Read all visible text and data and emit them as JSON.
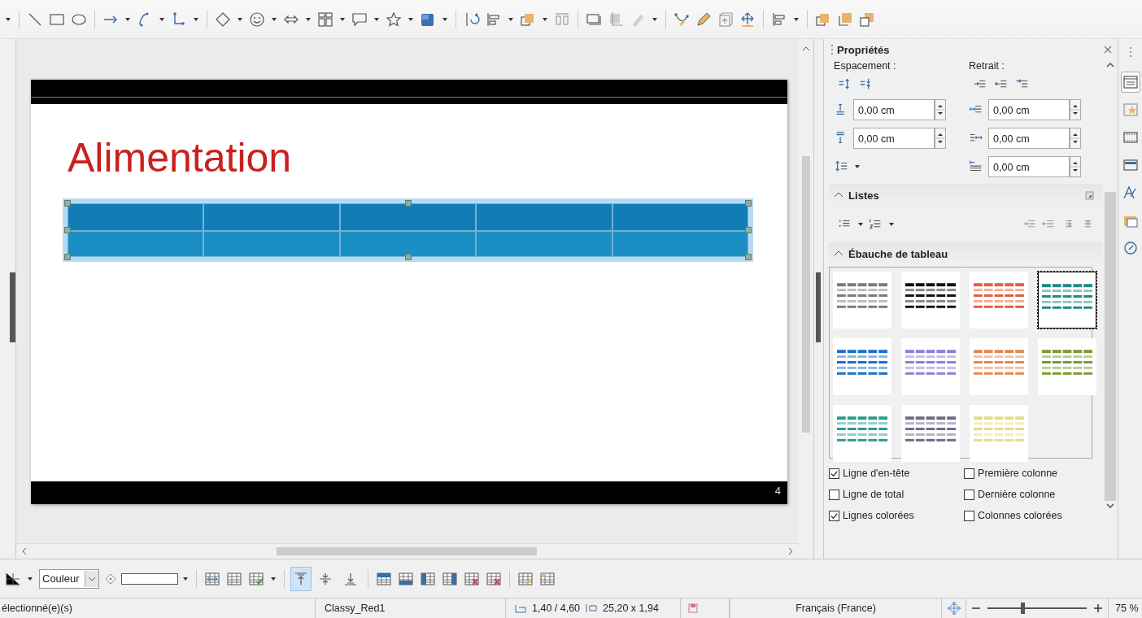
{
  "slide": {
    "title": "Alimentation",
    "page_number": "4",
    "table_selected": true
  },
  "sidebar": {
    "title": "Propriétés",
    "spacing": {
      "label": "Espacement :",
      "fields": [
        "0,00 cm",
        "0,00 cm"
      ]
    },
    "indent": {
      "label": "Retrait :",
      "fields": [
        "0,00 cm",
        "0,00 cm",
        "0,00 cm"
      ]
    },
    "sections": [
      {
        "title": "Listes",
        "expanded": true
      },
      {
        "title": "Ébauche de tableau",
        "expanded": true
      }
    ],
    "table_designs": [
      {
        "color": "#7a7a7a",
        "selected": false
      },
      {
        "color": "#111111",
        "selected": false
      },
      {
        "color": "#e2603a",
        "selected": false
      },
      {
        "color": "#1e8a84",
        "selected": true
      },
      {
        "color": "#1a6fc4",
        "selected": false
      },
      {
        "color": "#8b7fd6",
        "selected": false
      },
      {
        "color": "#e08a50",
        "selected": false
      },
      {
        "color": "#7a9a30",
        "selected": false
      },
      {
        "color": "#2a9a90",
        "selected": false
      },
      {
        "color": "#6a6a8a",
        "selected": false
      },
      {
        "color": "#e8dc80",
        "selected": false
      }
    ],
    "options": [
      {
        "label": "Ligne d'en-tête",
        "checked": true
      },
      {
        "label": "Première colonne",
        "checked": false
      },
      {
        "label": "Ligne de total",
        "checked": false
      },
      {
        "label": "Dernière colonne",
        "checked": false
      },
      {
        "label": "Lignes colorées",
        "checked": true
      },
      {
        "label": "Colonnes colorées",
        "checked": false
      }
    ]
  },
  "sidebar_tabs": [
    {
      "selected": true
    },
    {
      "selected": false
    },
    {
      "selected": false
    },
    {
      "selected": false
    },
    {
      "selected": false
    },
    {
      "selected": false
    },
    {
      "selected": false
    }
  ],
  "table_toolbar": {
    "fill_style": "Couleur",
    "vertical_align": [
      {
        "selected": true
      },
      {
        "selected": false
      },
      {
        "selected": false
      }
    ]
  },
  "status_bar": {
    "selection": "électionné(e)(s)",
    "layout": "Classy_Red1",
    "position": "1,40 / 4,60",
    "size": "25,20 x 1,94",
    "language": "Français (France)",
    "zoom": {
      "level": 0.35,
      "reading": "75 %"
    }
  }
}
